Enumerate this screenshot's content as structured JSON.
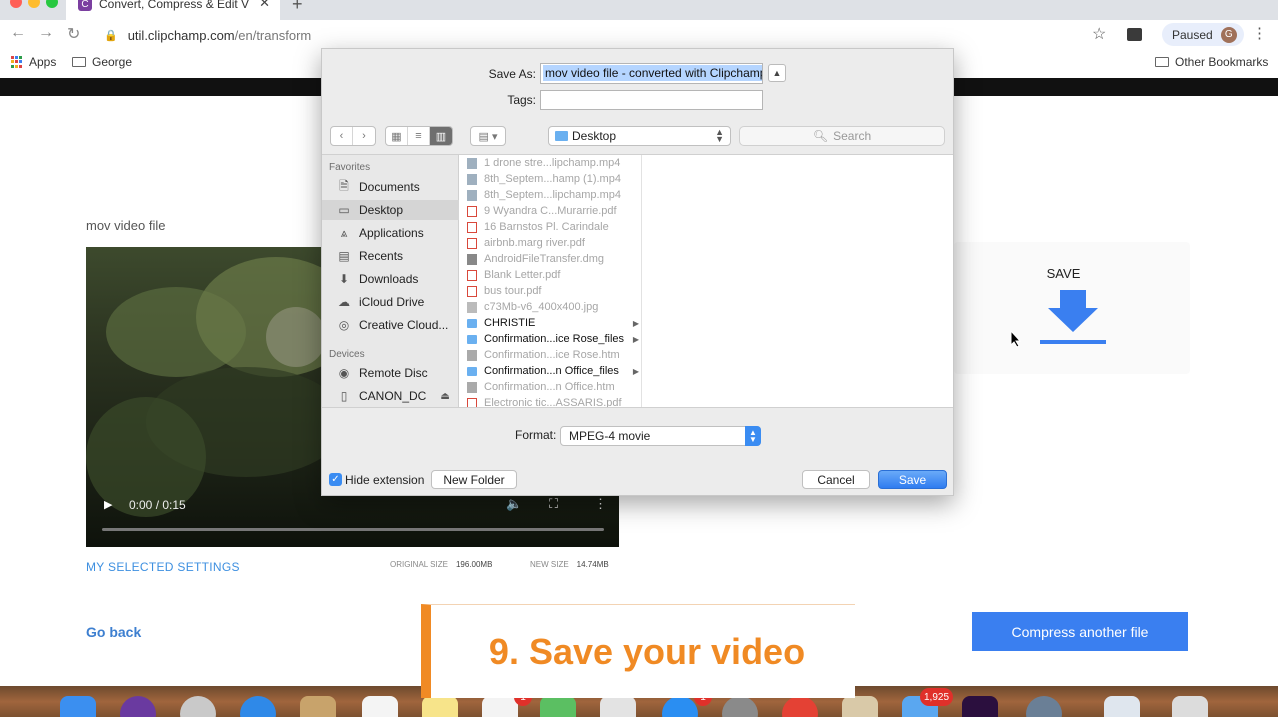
{
  "browser": {
    "tab_title": "Convert, Compress & Edit Video",
    "tab_favicon": "C",
    "url_host": "util.clipchamp.com",
    "url_path": "/en/transform",
    "profile_status": "Paused",
    "profile_initial": "G",
    "bookmarks": [
      "Apps",
      "George"
    ],
    "other_bookmarks": "Other Bookmarks"
  },
  "page": {
    "file_title": "mov video file",
    "video_time": "0:00 / 0:15",
    "settings_link": "MY SELECTED SETTINGS",
    "original_size_label": "ORIGINAL SIZE",
    "original_size_value": "196.00MB",
    "new_size_label": "NEW SIZE",
    "new_size_value": "14.74MB",
    "go_back": "Go back",
    "compress_another": "Compress another file",
    "save_label": "SAVE",
    "accent": "#3a7ff0"
  },
  "banner": {
    "text": "9. Save your video",
    "color": "#f08a24"
  },
  "dialog": {
    "save_as_label": "Save As:",
    "save_as_value": "mov video file - converted with Clipchamp",
    "tags_label": "Tags:",
    "location": "Desktop",
    "search_placeholder": "Search",
    "favorites_heading": "Favorites",
    "favorites": [
      "Documents",
      "Desktop",
      "Applications",
      "Recents",
      "Downloads",
      "iCloud Drive",
      "Creative Cloud..."
    ],
    "devices_heading": "Devices",
    "devices": [
      "Remote Disc",
      "CANON_DC"
    ],
    "files": [
      {
        "name": "1 drone stre...lipchamp.mp4",
        "kind": "video",
        "dim": true
      },
      {
        "name": "8th_Septem...hamp (1).mp4",
        "kind": "video",
        "dim": true
      },
      {
        "name": "8th_Septem...lipchamp.mp4",
        "kind": "video",
        "dim": true
      },
      {
        "name": "9 Wyandra C...Murarrie.pdf",
        "kind": "pdf",
        "dim": true
      },
      {
        "name": "16 Barnstos Pl. Carindale",
        "kind": "pdf",
        "dim": true
      },
      {
        "name": "airbnb.marg river.pdf",
        "kind": "pdf",
        "dim": true
      },
      {
        "name": "AndroidFileTransfer.dmg",
        "kind": "dmg",
        "dim": true
      },
      {
        "name": "Blank Letter.pdf",
        "kind": "pdf",
        "dim": true
      },
      {
        "name": "bus tour.pdf",
        "kind": "pdf",
        "dim": true
      },
      {
        "name": "c73Mb-v6_400x400.jpg",
        "kind": "image",
        "dim": true
      },
      {
        "name": "CHRISTIE",
        "kind": "folder",
        "dim": false
      },
      {
        "name": "Confirmation...ice Rose_files",
        "kind": "folder",
        "dim": false
      },
      {
        "name": "Confirmation...ice Rose.htm",
        "kind": "htm",
        "dim": true
      },
      {
        "name": "Confirmation...n Office_files",
        "kind": "folder",
        "dim": false
      },
      {
        "name": "Confirmation...n Office.htm",
        "kind": "htm",
        "dim": true
      },
      {
        "name": "Electronic tic...ASSARIS.pdf",
        "kind": "pdf",
        "dim": true
      }
    ],
    "format_label": "Format:",
    "format_value": "MPEG-4 movie",
    "hide_extension": "Hide extension",
    "new_folder": "New Folder",
    "cancel": "Cancel",
    "save": "Save"
  },
  "dock": {
    "badges": [
      "1",
      "1",
      "1,925"
    ]
  }
}
